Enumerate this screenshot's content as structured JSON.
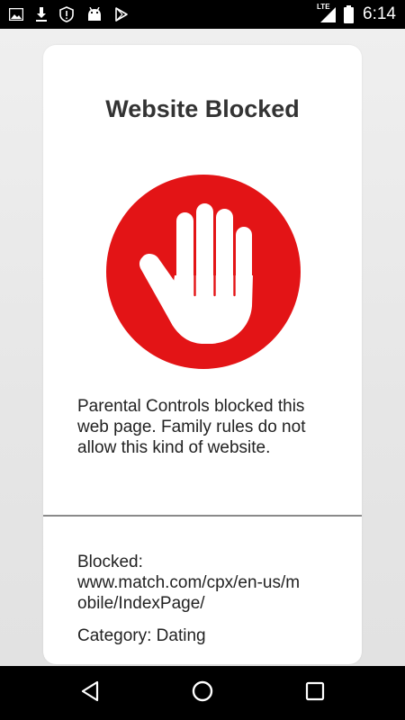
{
  "status_bar": {
    "time": "6:14",
    "network_label": "LTE",
    "left_icons": [
      "image-icon",
      "download-icon",
      "shield-icon",
      "android-icon",
      "play-store-icon"
    ],
    "right_icons": [
      "lte-signal-icon",
      "battery-icon"
    ]
  },
  "page": {
    "title": "Website Blocked",
    "icon": "stop-hand-icon",
    "message": "Parental Controls blocked this web page. Family rules do not allow this kind of website.",
    "blocked_label": "Blocked:",
    "blocked_url": "www.match.com/cpx/en-us/mobile/IndexPage/",
    "category": "Category: Dating"
  },
  "nav_bar": {
    "buttons": [
      "back-icon",
      "home-icon",
      "recents-icon"
    ]
  },
  "colors": {
    "stop_red": "#E31416",
    "title_text": "#333333",
    "body_text": "#222222",
    "background": "#E6E6E6",
    "card": "#FFFFFF",
    "bars": "#000000"
  }
}
